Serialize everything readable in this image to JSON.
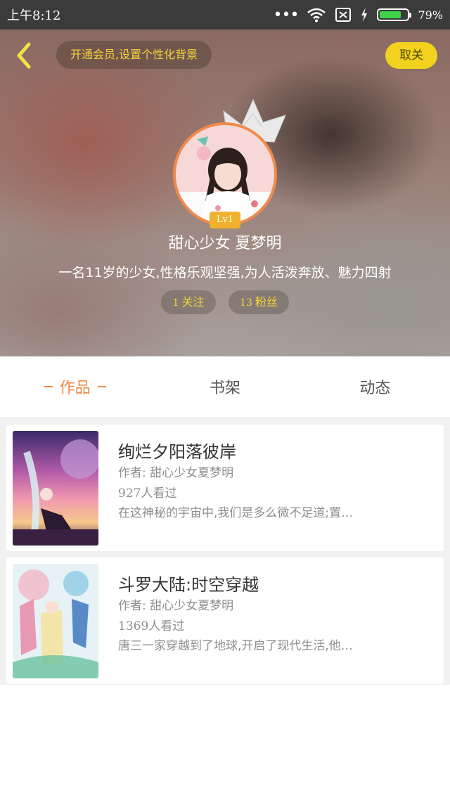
{
  "status_bar": {
    "time": "上午8:12",
    "battery_percent": "79%",
    "battery_level": 0.79,
    "icons": [
      "more-dots-icon",
      "wifi-icon",
      "no-sim-icon",
      "charging-icon",
      "battery-icon"
    ]
  },
  "header": {
    "back_icon": "chevron-left-icon",
    "vip_prompt": "开通会员,设置个性化背景",
    "unfollow_label": "取关",
    "level": "Lv1",
    "nickname": "甜心少女 夏梦明",
    "bio": "一名11岁的少女,性格乐观坚强,为人活泼奔放、魅力四射",
    "following": {
      "count": "1",
      "label": "关注"
    },
    "fans": {
      "count": "13",
      "label": "粉丝"
    },
    "colors": {
      "accent_yellow": "#f2d21e",
      "avatar_ring": "#f08a4b",
      "pill_text": "#f4d43a"
    }
  },
  "tabs": [
    {
      "label": "作品",
      "active": true
    },
    {
      "label": "书架",
      "active": false
    },
    {
      "label": "动态",
      "active": false
    }
  ],
  "works": [
    {
      "title": "绚烂夕阳落彼岸",
      "author": "作者: 甜心少女夏梦明",
      "views": "927人看过",
      "desc": "在这神秘的宇宙中,我们是多么微不足道;置…"
    },
    {
      "title": "斗罗大陆:时空穿越",
      "author": "作者: 甜心少女夏梦明",
      "views": "1369人看过",
      "desc": "唐三一家穿越到了地球,开启了现代生活,他…"
    }
  ],
  "accent_color": "#ef8a4a"
}
